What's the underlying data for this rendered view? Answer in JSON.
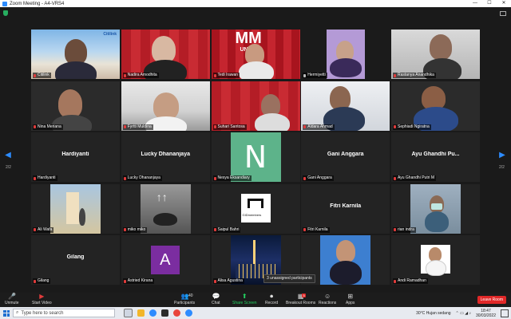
{
  "window": {
    "title": "Zoom Meeting - A4-VRS4"
  },
  "navigation": {
    "left_page": "2/2",
    "right_page": "2/2"
  },
  "tiles": [
    {
      "name": "Citilink",
      "center": ""
    },
    {
      "name": "Nadira Amodhita",
      "center": ""
    },
    {
      "name": "Tedi Irawan",
      "center": ""
    },
    {
      "name": "Hermiyetti",
      "center": ""
    },
    {
      "name": "Rastanya Anandhika",
      "center": ""
    },
    {
      "name": "Nina Meriana",
      "center": ""
    },
    {
      "name": "Fyrtti Muldina",
      "center": ""
    },
    {
      "name": "Suhari Santosa",
      "center": ""
    },
    {
      "name": "Aldara Ahmad",
      "center": ""
    },
    {
      "name": "Sephiadi Ngiratna",
      "center": ""
    },
    {
      "name": "Hardiyanti",
      "center": "Hardiyanti"
    },
    {
      "name": "Lucky Dhananjaya",
      "center": "Lucky Dhananjaya"
    },
    {
      "name": "Nesya Eksandiary",
      "center": ""
    },
    {
      "name": "Gani Anggara",
      "center": "Gani Anggara"
    },
    {
      "name": "Ayu Ghandhi Putri M",
      "center": "Ayu Ghandhi Pu..."
    },
    {
      "name": "Ali Wafa",
      "center": ""
    },
    {
      "name": "miko miko",
      "center": ""
    },
    {
      "name": "Saipul Bahri",
      "center": ""
    },
    {
      "name": "Fitri Karnila",
      "center": "Fitri Karnila"
    },
    {
      "name": "rian indra",
      "center": ""
    },
    {
      "name": "Gilang",
      "center": "Gilang"
    },
    {
      "name": "Astried Kirana",
      "center": ""
    },
    {
      "name": "Alisa Agustina",
      "center": ""
    },
    {
      "name": "",
      "center": ""
    },
    {
      "name": "Andi Ramadhan",
      "center": ""
    }
  ],
  "tile_text": {
    "citilink": "Citilink",
    "mm": "MM",
    "uniq": "UNIQUE",
    "avatar_n": "N",
    "avatar_a": "A",
    "logo": "GIDmembers"
  },
  "unassigned": "3 unassigned participants",
  "toolbar": {
    "unmute": "Unmute",
    "start_video": "Start Video",
    "participants": "Participants",
    "participants_count": "40",
    "chat": "Chat",
    "share_screen": "Share Screen",
    "record": "Record",
    "breakout_rooms": "Breakout Rooms",
    "breakout_badge": "5",
    "reactions": "Reactions",
    "apps": "Apps",
    "leave": "Leave Room"
  },
  "taskbar": {
    "search_placeholder": "Type here to search",
    "weather": "30°C  Hujan sedang",
    "time": "18:47",
    "date": "30/03/2022"
  },
  "colors": {
    "accent": "#2d8cff",
    "active_speaker": "#c8e03a",
    "leave": "#e02828",
    "share": "#23d160"
  }
}
